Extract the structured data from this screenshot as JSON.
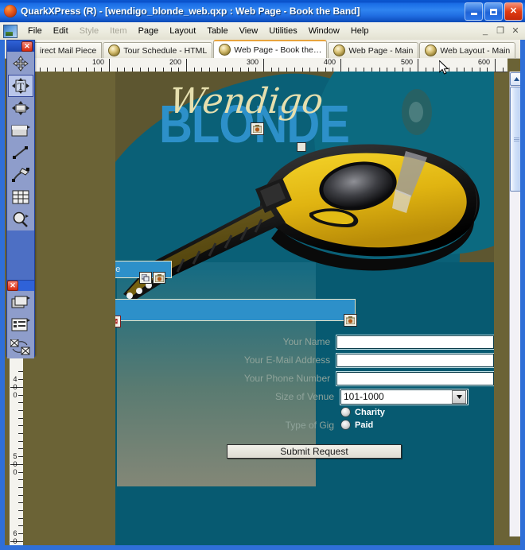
{
  "window": {
    "title": "QuarkXPress (R) - [wendigo_blonde_web.qxp : Web Page - Book the Band]",
    "app_icon": "quark-logo-icon",
    "minimize_label": "_",
    "maximize_label": "□",
    "close_label": "✕"
  },
  "mdi_controls": {
    "minimize": "_",
    "restore": "❐",
    "close": "✕"
  },
  "menubar": {
    "items": [
      {
        "label": "File",
        "disabled": false
      },
      {
        "label": "Edit",
        "disabled": false
      },
      {
        "label": "Style",
        "disabled": true
      },
      {
        "label": "Item",
        "disabled": true
      },
      {
        "label": "Page",
        "disabled": false
      },
      {
        "label": "Layout",
        "disabled": false
      },
      {
        "label": "Table",
        "disabled": false
      },
      {
        "label": "View",
        "disabled": false
      },
      {
        "label": "Utilities",
        "disabled": false
      },
      {
        "label": "Window",
        "disabled": false
      },
      {
        "label": "Help",
        "disabled": false
      }
    ]
  },
  "tabs": [
    {
      "label": "irect Mail Piece",
      "active": false
    },
    {
      "label": "Tour Schedule - HTML",
      "active": false
    },
    {
      "label": "Web Page - Book the…",
      "active": true
    },
    {
      "label": "Web Page - Main",
      "active": false
    },
    {
      "label": "Web Layout - Main",
      "active": false
    }
  ],
  "tools": {
    "close_label": "✕",
    "items": [
      {
        "name": "item-tool",
        "selected": false
      },
      {
        "name": "text-content-tool",
        "selected": true
      },
      {
        "name": "rotation-tool",
        "selected": false
      },
      {
        "name": "rectangle-box-tool",
        "selected": false
      },
      {
        "name": "line-tool",
        "selected": false
      },
      {
        "name": "bezier-pen-tool",
        "selected": false
      },
      {
        "name": "table-tool",
        "selected": false
      },
      {
        "name": "zoom-tool",
        "selected": false
      }
    ],
    "items2": [
      {
        "name": "stacked-boxes-tool",
        "selected": false
      },
      {
        "name": "list-box-tool",
        "selected": false
      },
      {
        "name": "rollover-tool",
        "selected": false
      }
    ]
  },
  "rulers": {
    "horizontal": {
      "labels": [
        "100",
        "200",
        "300",
        "400",
        "500",
        "600"
      ],
      "unit": "points"
    },
    "vertical": {
      "labels": [
        "400",
        "500",
        "600"
      ],
      "unit": "points"
    }
  },
  "page": {
    "logo": {
      "script_word": "Wendigo",
      "block_word": "BLONDE",
      "script_color": "#e6dfae",
      "block_color": "#2d90c9"
    },
    "nav_bar": {
      "label": "Navigate",
      "bg_color": "#2d90c9"
    },
    "blue_box": {
      "label": "",
      "bg_color": "#2d90c9"
    },
    "background_colors": {
      "olive": "#5d5630",
      "teal": "#075a71",
      "pasteboard": "#6b6336"
    },
    "image": {
      "name": "electric-guitar-photo",
      "body_color": "#e8c21c",
      "edge_color": "#111111"
    },
    "form": {
      "fields": [
        {
          "label": "Your Name",
          "value": "",
          "type": "text"
        },
        {
          "label": "Your E-Mail Address",
          "value": "",
          "type": "text"
        },
        {
          "label": "Your Phone Number",
          "value": "",
          "type": "text"
        }
      ],
      "select": {
        "label": "Size of Venue",
        "value": "101-1000",
        "options": [
          "101-1000"
        ]
      },
      "radio_group": {
        "label": "Type of Gig",
        "options": [
          {
            "label": "Charity",
            "checked": false
          },
          {
            "label": "Paid",
            "checked": false
          }
        ]
      },
      "submit_label": "Submit Request",
      "label_color": "#8fa39a"
    }
  },
  "scrollbar": {
    "up_arrow": "▲",
    "down_arrow": "▼"
  }
}
